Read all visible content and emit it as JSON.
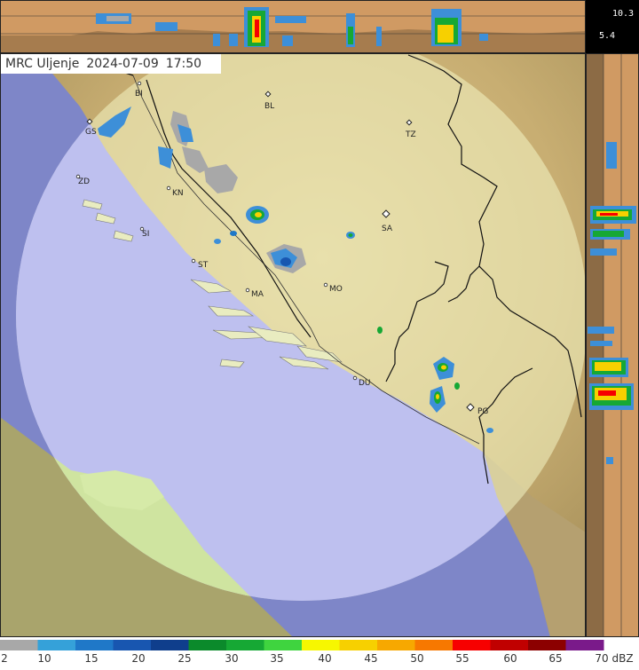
{
  "title": {
    "station": "MRC Uljenje",
    "date": "2024-07-09",
    "time": "17:50"
  },
  "height_scale": {
    "top": "10.3",
    "middle": "5.4"
  },
  "cities": [
    {
      "code": "BI"
    },
    {
      "code": "BL"
    },
    {
      "code": "GS"
    },
    {
      "code": "TZ"
    },
    {
      "code": "ZD"
    },
    {
      "code": "KN"
    },
    {
      "code": "SA"
    },
    {
      "code": "SI"
    },
    {
      "code": "ST"
    },
    {
      "code": "MO"
    },
    {
      "code": "MA"
    },
    {
      "code": "DU"
    },
    {
      "code": "PG"
    }
  ],
  "legend": {
    "unit": "dBZ",
    "ticks": [
      "2",
      "10",
      "15",
      "20",
      "25",
      "30",
      "35",
      "40",
      "45",
      "50",
      "55",
      "60",
      "65",
      "70"
    ],
    "colors": [
      "#a8a8a8",
      "#35a1d9",
      "#1f78c8",
      "#1856b0",
      "#0f3e8c",
      "#0b8a2b",
      "#16a834",
      "#3fd43f",
      "#f7f700",
      "#f7d000",
      "#f7a800",
      "#f77800",
      "#f70000",
      "#c00000",
      "#8c0000",
      "#7a1a8a"
    ],
    "last_label": "70 dBZ"
  },
  "colors": {
    "land": "#d4ba7c",
    "sea": "#b9bdf4",
    "panel": "#d09a63",
    "radar_fill": "#f3f5c2"
  }
}
